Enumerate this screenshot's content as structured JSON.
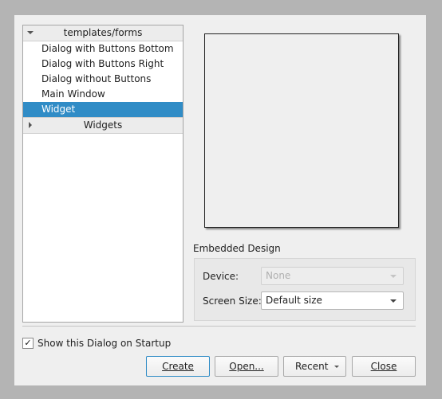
{
  "tree": {
    "group_label": "templates/forms",
    "items": [
      {
        "label": "Dialog with Buttons Bottom"
      },
      {
        "label": "Dialog with Buttons Right"
      },
      {
        "label": "Dialog without Buttons"
      },
      {
        "label": "Main Window"
      },
      {
        "label": "Widget"
      }
    ],
    "selected_item": "Widget",
    "collapsed_group_label": "Widgets"
  },
  "embedded": {
    "title": "Embedded Design",
    "device_label": "Device:",
    "device_value": "None",
    "screen_size_label": "Screen Size:",
    "screen_size_value": "Default size"
  },
  "startup": {
    "label": "Show this Dialog on Startup",
    "checked": true,
    "check_glyph": "✓"
  },
  "buttons": {
    "create": "Create",
    "open": "Open...",
    "recent": "Recent",
    "close": "Close"
  },
  "colors": {
    "selection": "#308cc6",
    "dialog_background": "#efefef"
  }
}
